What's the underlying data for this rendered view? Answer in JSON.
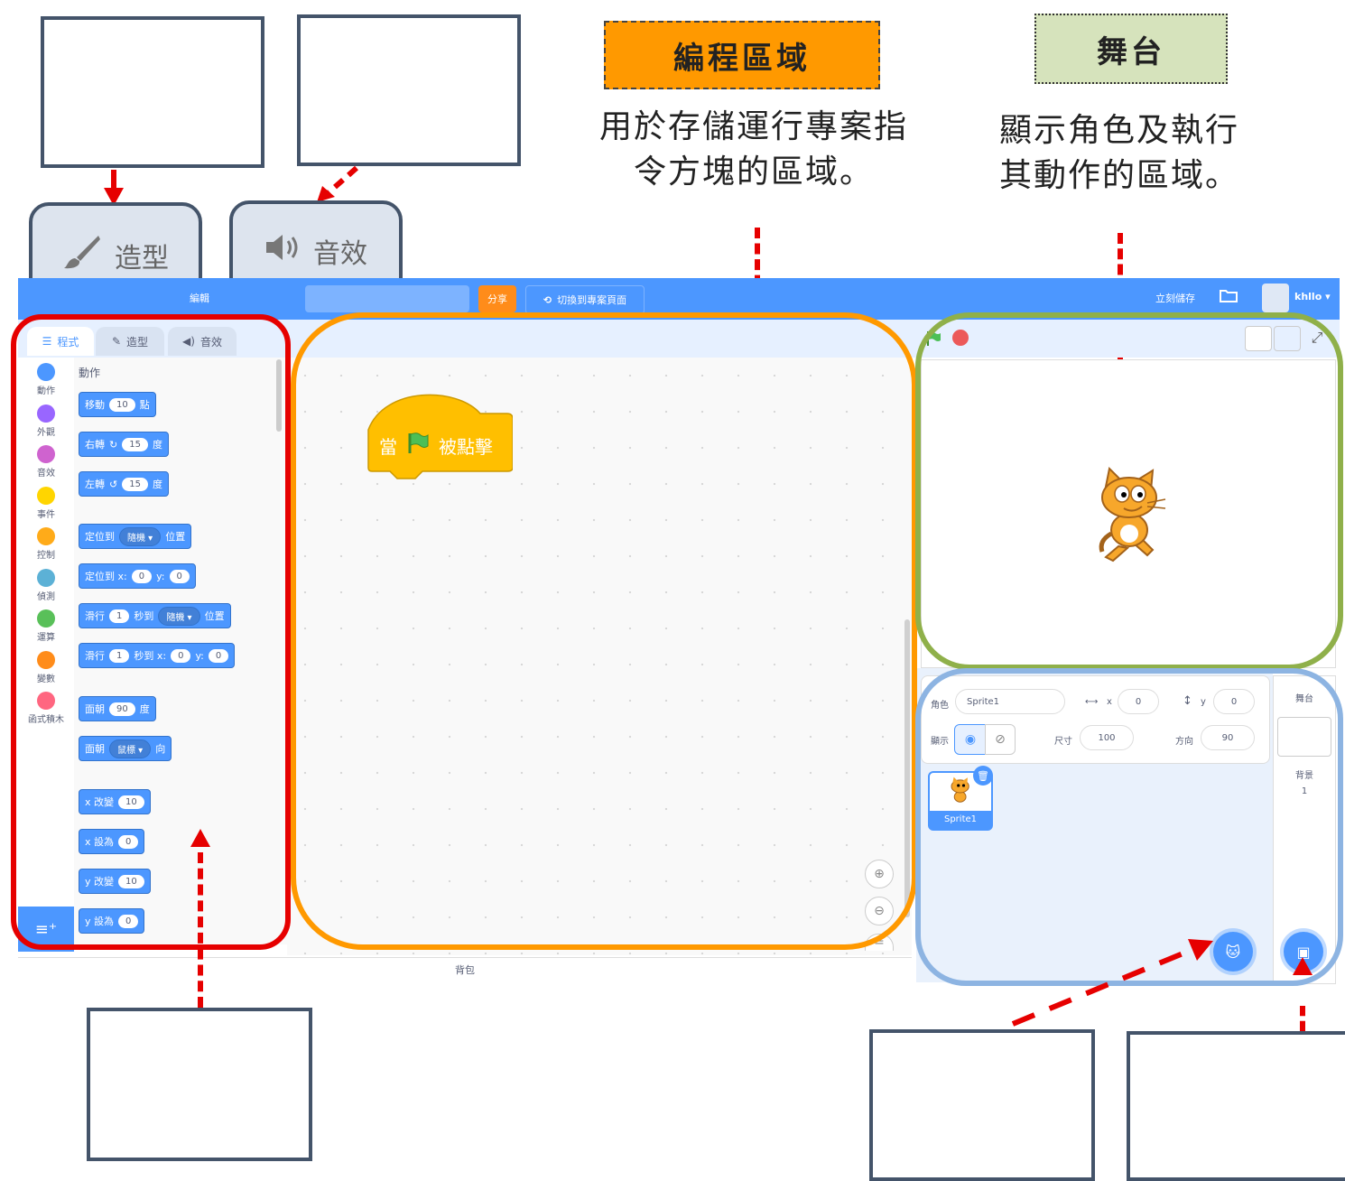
{
  "labels": {
    "coding_area_title": "編程區域",
    "coding_area_desc_line1": "用於存儲運行專案指",
    "coding_area_desc_line2": "令方塊的區域。",
    "stage_title": "舞台",
    "stage_desc_line1": "顯示角色及執行",
    "stage_desc_line2": "其動作的區域。"
  },
  "callouts": {
    "costumes": "造型",
    "sounds": "音效"
  },
  "menubar": {
    "edit_menu": "編輯",
    "share_button": "分享",
    "see_project_page": "切換到專案頁面",
    "save_now": "立刻儲存",
    "username": "khllo"
  },
  "tabs": {
    "code": "程式",
    "costumes": "造型",
    "sounds": "音效"
  },
  "categories": [
    {
      "label": "動作",
      "color": "#4c97ff"
    },
    {
      "label": "外觀",
      "color": "#9966ff"
    },
    {
      "label": "音效",
      "color": "#cf63cf"
    },
    {
      "label": "事件",
      "color": "#ffd500"
    },
    {
      "label": "控制",
      "color": "#ffab19"
    },
    {
      "label": "偵測",
      "color": "#5cb1d6"
    },
    {
      "label": "運算",
      "color": "#59c059"
    },
    {
      "label": "變數",
      "color": "#ff8c1a"
    },
    {
      "label": "函式積木",
      "color": "#ff6680"
    }
  ],
  "palette": {
    "heading": "動作",
    "blocks": {
      "move": {
        "a": "移動",
        "v": "10",
        "b": "點"
      },
      "turn_right": {
        "a": "右轉",
        "v": "15",
        "b": "度"
      },
      "turn_left": {
        "a": "左轉",
        "v": "15",
        "b": "度"
      },
      "goto": {
        "a": "定位到",
        "dd": "隨機",
        "b": "位置"
      },
      "goto_xy": {
        "a": "定位到 x:",
        "x": "0",
        "ylbl": "y:",
        "y": "0"
      },
      "glide": {
        "a": "滑行",
        "v": "1",
        "b": "秒到",
        "dd": "隨機",
        "c": "位置"
      },
      "glide_xy": {
        "a": "滑行",
        "v": "1",
        "b": "秒到 x:",
        "x": "0",
        "ylbl": "y:",
        "y": "0"
      },
      "point_dir": {
        "a": "面朝",
        "v": "90",
        "b": "度"
      },
      "point_towards": {
        "a": "面朝",
        "dd": "鼠標",
        "b": "向"
      },
      "change_x": {
        "a": "x 改變",
        "v": "10"
      },
      "set_x": {
        "a": "x 設為",
        "v": "0"
      },
      "change_y": {
        "a": "y 改變",
        "v": "10"
      },
      "set_y": {
        "a": "y 設為",
        "v": "0"
      }
    }
  },
  "workspace": {
    "hat_block": {
      "a": "當",
      "b": "被點擊"
    }
  },
  "backpack": "背包",
  "sprite_info": {
    "sprite_label": "角色",
    "sprite_name": "Sprite1",
    "x_label": "x",
    "x_value": "0",
    "y_label": "y",
    "y_value": "0",
    "show_label": "顯示",
    "size_label": "尺寸",
    "size_value": "100",
    "direction_label": "方向",
    "direction_value": "90"
  },
  "sprite_thumb": "Sprite1",
  "stage_col": {
    "title": "舞台",
    "backdrops_label": "背景",
    "backdrops_count": "1"
  },
  "colors": {
    "scratch_blue": "#4c97ff",
    "red_frame": "#e60000",
    "orange_frame": "#ff9900",
    "green_frame": "#8fb04a",
    "blue_frame": "#8db4e2"
  }
}
